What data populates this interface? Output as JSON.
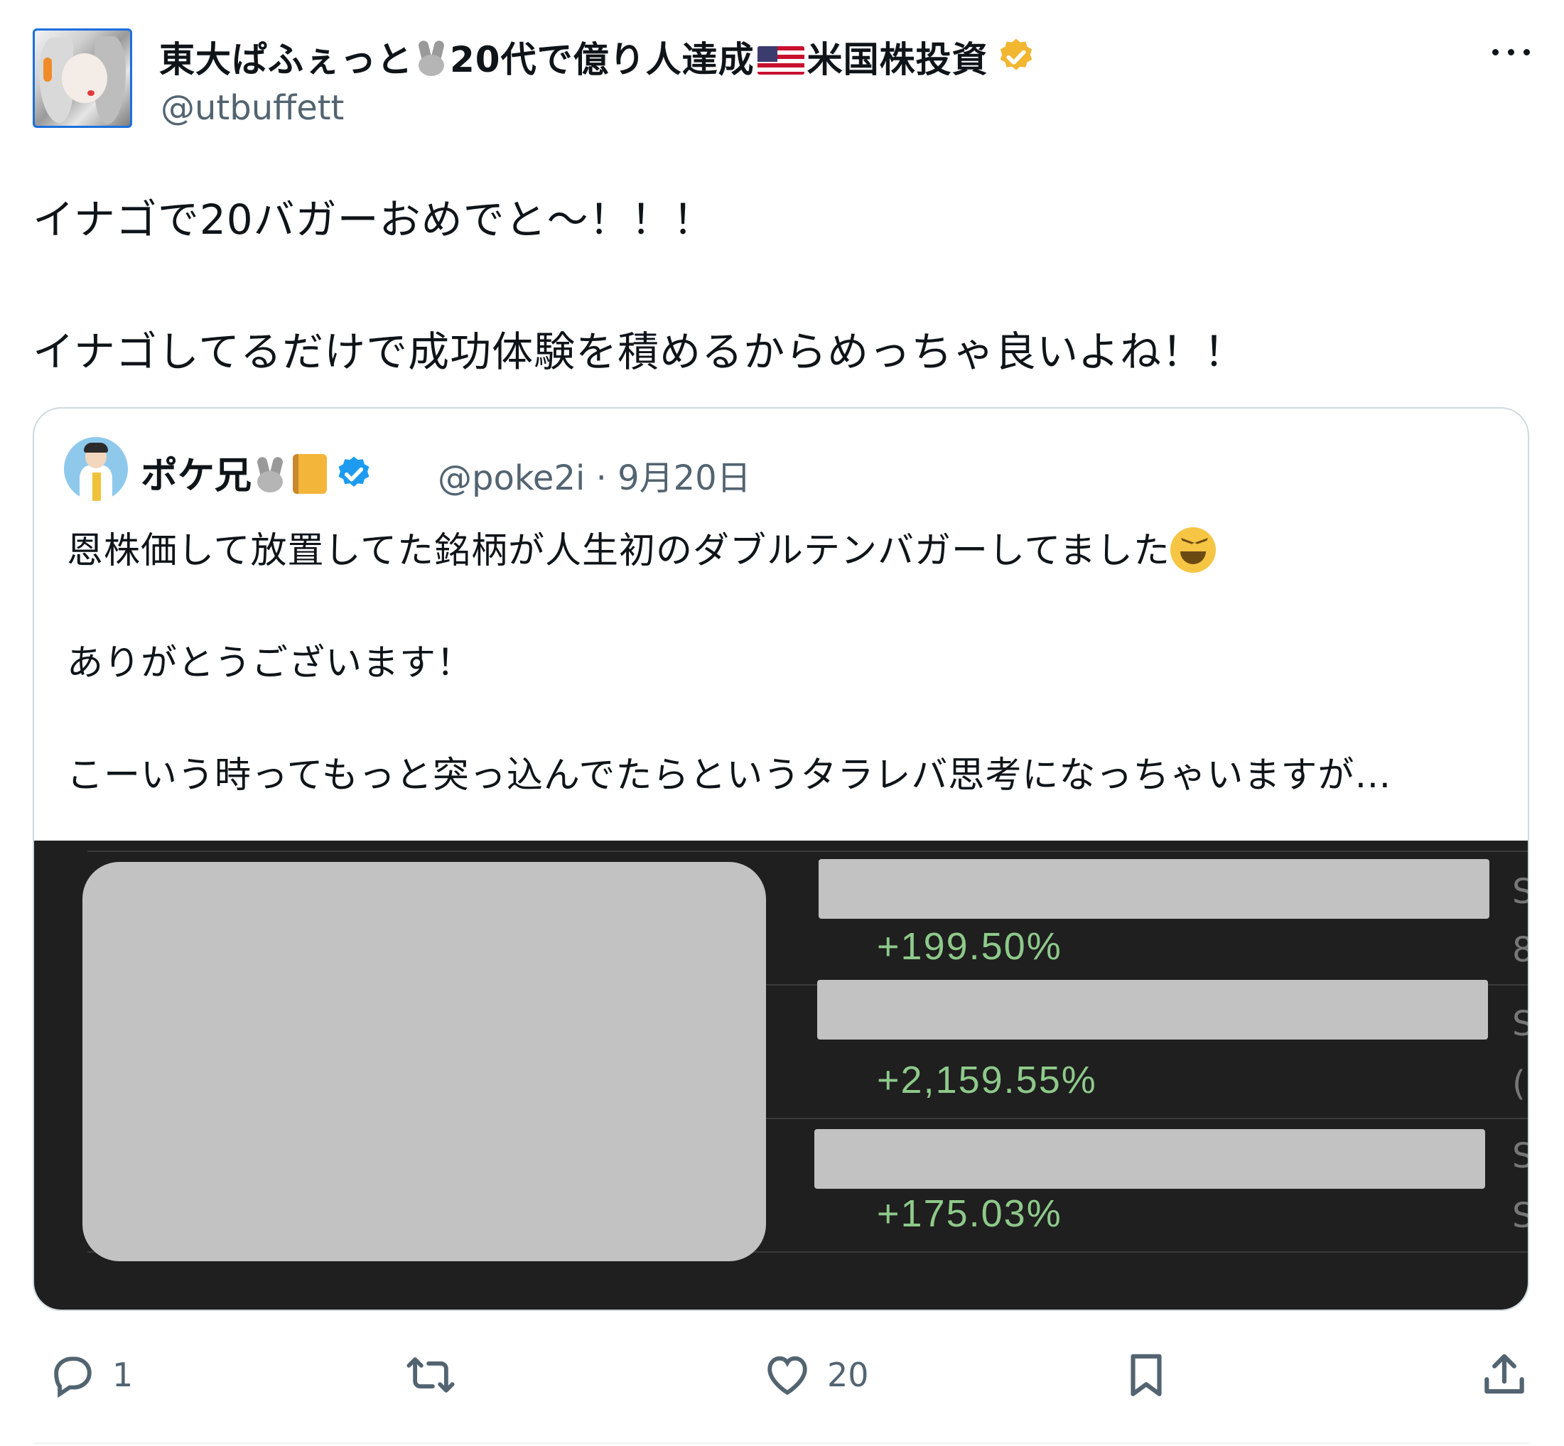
{
  "author": {
    "display_name_part1": "東大ぱふぇっと",
    "display_name_part2": "20代で億り人達成",
    "display_name_part3": "米国株投資",
    "handle": "@utbuffett"
  },
  "post": {
    "line1": "イナゴで20バガーおめでと〜！！！",
    "line2": "イナゴしてるだけで成功体験を積めるからめっちゃ良いよね！！"
  },
  "quote": {
    "display_name": "ポケ兄",
    "handle_date": "@poke2i · 9月20日",
    "line1": "恩株価して放置してた銘柄が人生初のダブルテンバガーしてました",
    "line2": "ありがとうございます！",
    "line3": "こーいう時ってもっと突っ込んでたらというタラレバ思考になっちゃいますが…",
    "image": {
      "rows": [
        {
          "change": "+199.50%"
        },
        {
          "change": "+2,159.55%"
        },
        {
          "change": "+175.03%"
        }
      ],
      "edge_glyphs": [
        "S",
        "8",
        "S",
        "(",
        "S",
        "S"
      ]
    }
  },
  "actions": {
    "reply_count": "1",
    "like_count": "20"
  },
  "icons": [
    "reply-icon",
    "repost-icon",
    "like-icon",
    "bookmark-icon",
    "share-icon",
    "more-icon",
    "verified-badge-icon"
  ],
  "colors": {
    "gold_badge": "#f2b631",
    "blue_badge": "#1d9bf0",
    "positive_change": "#8ec98a",
    "muted_text": "#536471"
  }
}
